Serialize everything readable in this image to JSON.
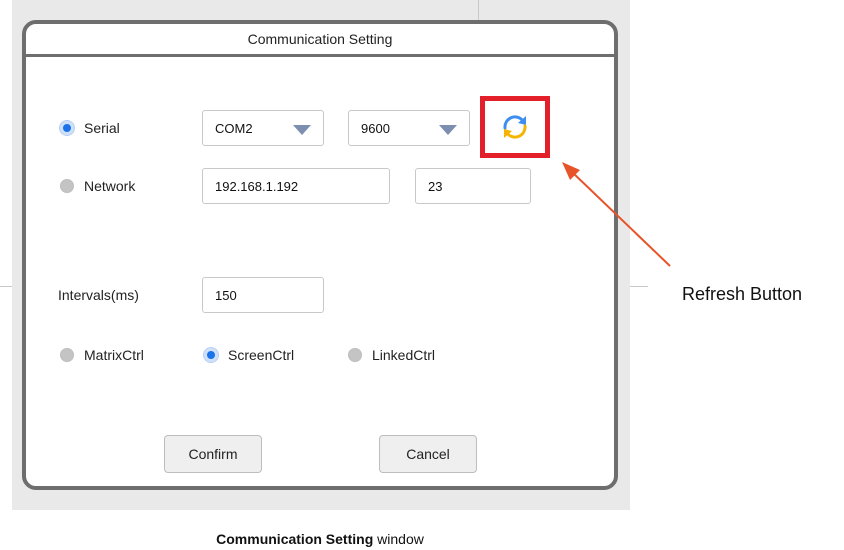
{
  "window": {
    "title": "Communication Setting"
  },
  "connection": {
    "serial": {
      "label": "Serial",
      "selected": true,
      "port": "COM2",
      "baud": "9600"
    },
    "network": {
      "label": "Network",
      "selected": false,
      "ip": "192.168.1.192",
      "port": "23"
    }
  },
  "intervals": {
    "label": "Intervals(ms)",
    "value": "150"
  },
  "mode": {
    "options": [
      {
        "label": "MatrixCtrl",
        "selected": false
      },
      {
        "label": "ScreenCtrl",
        "selected": true
      },
      {
        "label": "LinkedCtrl",
        "selected": false
      }
    ]
  },
  "buttons": {
    "confirm": "Confirm",
    "cancel": "Cancel"
  },
  "refresh": {
    "icon": "refresh-icon"
  },
  "annotation": {
    "text": "Refresh Button",
    "color": "#e8542a",
    "highlight_color": "#e3202a"
  },
  "caption": {
    "bold": "Communication Setting",
    "rest": " window"
  },
  "colors": {
    "accent": "#1a73e8",
    "frame": "#6e6e6e"
  }
}
